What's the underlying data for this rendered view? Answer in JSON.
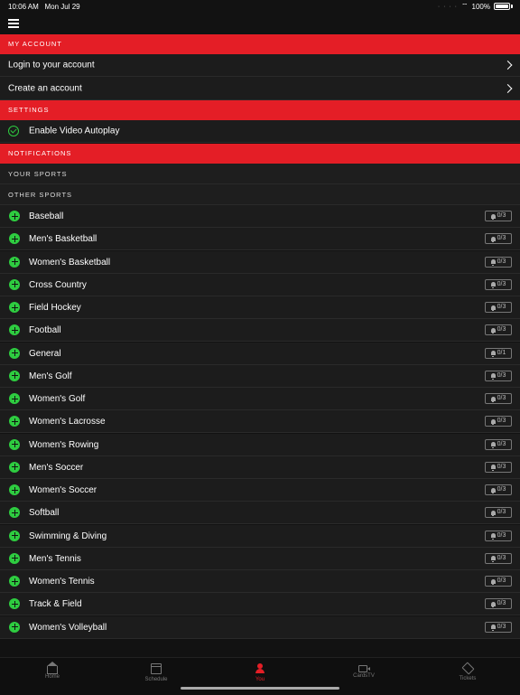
{
  "status": {
    "time": "10:06 AM",
    "date": "Mon Jul 29",
    "battery": "100%"
  },
  "sections": {
    "my_account": "MY ACCOUNT",
    "settings": "SETTINGS",
    "notifications": "NOTIFICATIONS",
    "your_sports": "YOUR SPORTS",
    "other_sports": "OTHER SPORTS"
  },
  "account": {
    "login": "Login to your account",
    "create": "Create an account"
  },
  "settings": {
    "autoplay": "Enable Video Autoplay"
  },
  "sports": [
    {
      "name": "Baseball",
      "count": "0/3"
    },
    {
      "name": "Men's Basketball",
      "count": "0/3"
    },
    {
      "name": "Women's Basketball",
      "count": "0/3"
    },
    {
      "name": "Cross Country",
      "count": "0/3"
    },
    {
      "name": "Field Hockey",
      "count": "0/3"
    },
    {
      "name": "Football",
      "count": "0/3"
    },
    {
      "name": "General",
      "count": "0/1"
    },
    {
      "name": "Men's Golf",
      "count": "0/3"
    },
    {
      "name": "Women's Golf",
      "count": "0/3"
    },
    {
      "name": "Women's Lacrosse",
      "count": "0/3"
    },
    {
      "name": "Women's Rowing",
      "count": "0/3"
    },
    {
      "name": "Men's Soccer",
      "count": "0/3"
    },
    {
      "name": "Women's Soccer",
      "count": "0/3"
    },
    {
      "name": "Softball",
      "count": "0/3"
    },
    {
      "name": "Swimming & Diving",
      "count": "0/3"
    },
    {
      "name": "Men's Tennis",
      "count": "0/3"
    },
    {
      "name": "Women's Tennis",
      "count": "0/3"
    },
    {
      "name": "Track & Field",
      "count": "0/3"
    },
    {
      "name": "Women's Volleyball",
      "count": "0/3"
    }
  ],
  "tabs": [
    {
      "label": "Home",
      "icon": "home-icon"
    },
    {
      "label": "Schedule",
      "icon": "calendar-icon"
    },
    {
      "label": "You",
      "icon": "user-icon"
    },
    {
      "label": "CardsTV",
      "icon": "video-icon"
    },
    {
      "label": "Tickets",
      "icon": "ticket-icon"
    }
  ],
  "colors": {
    "accent": "#e41e26",
    "success": "#2ecc40",
    "background": "#121212"
  }
}
